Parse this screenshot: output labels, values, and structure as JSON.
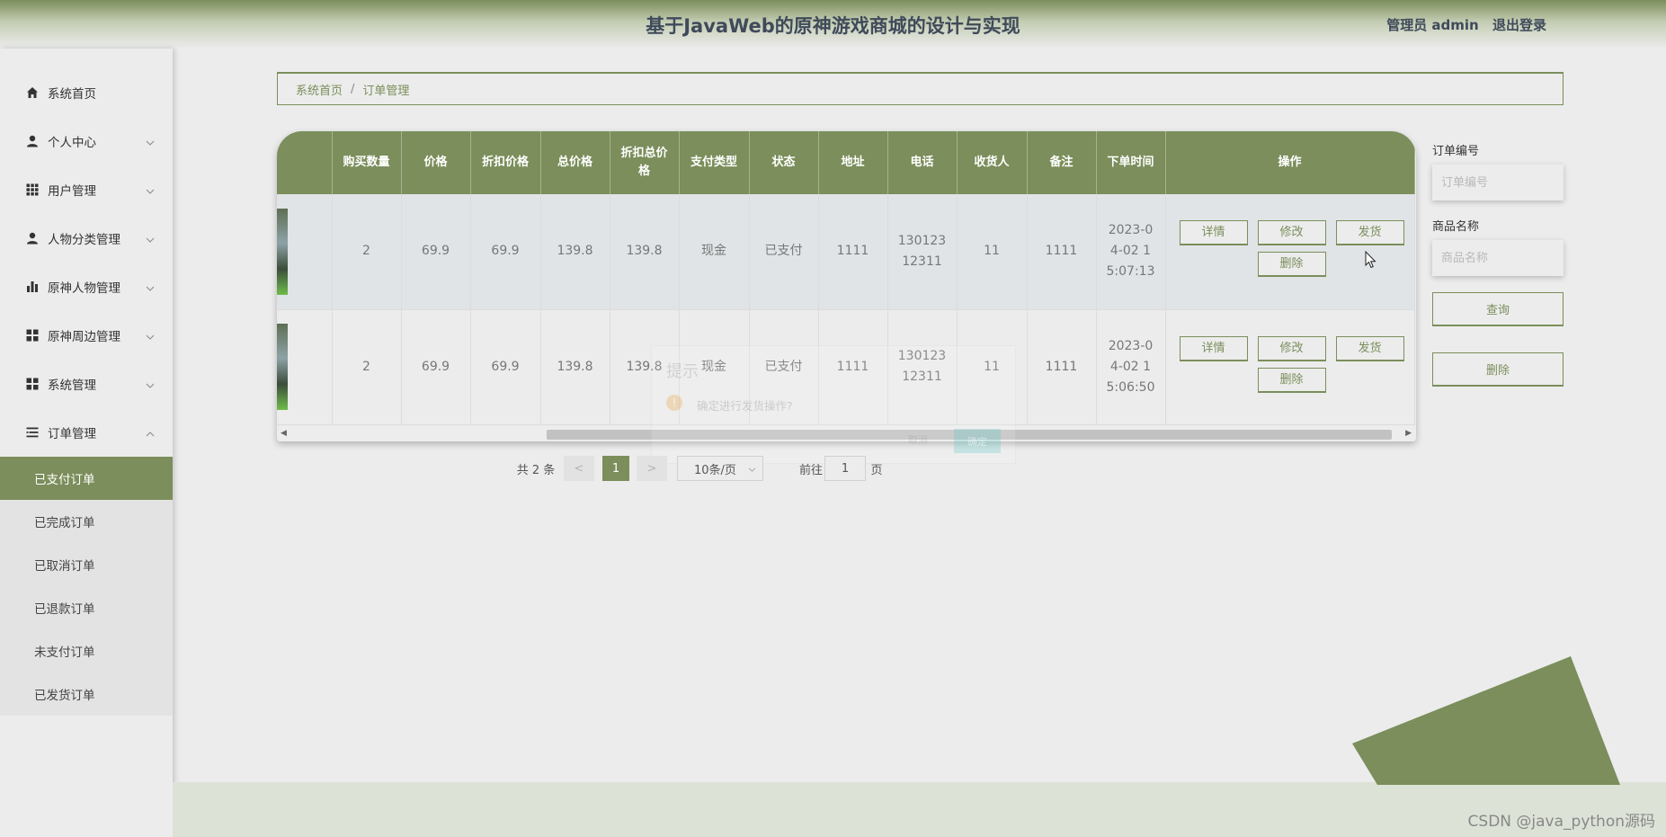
{
  "header": {
    "title": "基于JavaWeb的原神游戏商城的设计与实现",
    "user_label": "管理员 admin",
    "logout_label": "退出登录"
  },
  "sidebar": {
    "items": [
      {
        "label": "系统首页",
        "icon": "home-icon",
        "expandable": false
      },
      {
        "label": "个人中心",
        "icon": "user-icon",
        "expandable": true
      },
      {
        "label": "用户管理",
        "icon": "grid-icon",
        "expandable": true
      },
      {
        "label": "人物分类管理",
        "icon": "user-icon",
        "expandable": true
      },
      {
        "label": "原神人物管理",
        "icon": "bar-chart-icon",
        "expandable": true
      },
      {
        "label": "原神周边管理",
        "icon": "apps-icon",
        "expandable": true
      },
      {
        "label": "系统管理",
        "icon": "apps-icon",
        "expandable": true
      },
      {
        "label": "订单管理",
        "icon": "list-icon",
        "expandable": true,
        "expanded": true
      }
    ],
    "sub_items": [
      "已支付订单",
      "已完成订单",
      "已取消订单",
      "已退款订单",
      "未支付订单",
      "已发货订单"
    ],
    "active_sub_item": "已支付订单"
  },
  "breadcrumb": {
    "home": "系统首页",
    "separator": "/",
    "current": "订单管理"
  },
  "table": {
    "columns": [
      "",
      "购买数量",
      "价格",
      "折扣价格",
      "总价格",
      "折扣总价格",
      "支付类型",
      "状态",
      "地址",
      "电话",
      "收货人",
      "备注",
      "下单时间",
      "操作"
    ],
    "rows": [
      {
        "quantity": "2",
        "price": "69.9",
        "discount_price": "69.9",
        "total_price": "139.8",
        "discount_total": "139.8",
        "pay_type": "现金",
        "status": "已支付",
        "address": "1111",
        "phone": "13012312311",
        "receiver": "11",
        "remark": "1111",
        "order_time": "2023-04-02 15:07:13"
      },
      {
        "quantity": "2",
        "price": "69.9",
        "discount_price": "69.9",
        "total_price": "139.8",
        "discount_total": "139.8",
        "pay_type": "现金",
        "status": "已支付",
        "address": "1111",
        "phone": "13012312311",
        "receiver": "11",
        "remark": "1111",
        "order_time": "2023-04-02 15:06:50"
      }
    ],
    "actions": {
      "detail": "详情",
      "edit": "修改",
      "ship": "发货",
      "delete": "删除"
    }
  },
  "dialog": {
    "title": "提示",
    "message": "确定进行发货操作?",
    "cancel": "取消",
    "confirm": "确定"
  },
  "pagination": {
    "total": "共 2 条",
    "prev": "<",
    "current_page": "1",
    "next": ">",
    "page_size": "10条/页",
    "goto_label": "前往",
    "goto_value": "1",
    "goto_unit": "页"
  },
  "search": {
    "order_no_label": "订单编号",
    "order_no_placeholder": "订单编号",
    "product_label": "商品名称",
    "product_placeholder": "商品名称",
    "query_button": "查询",
    "delete_button": "删除"
  },
  "watermark": "CSDN @java_python源码",
  "colors": {
    "accent": "#7b8e5b",
    "background": "#ececec"
  }
}
